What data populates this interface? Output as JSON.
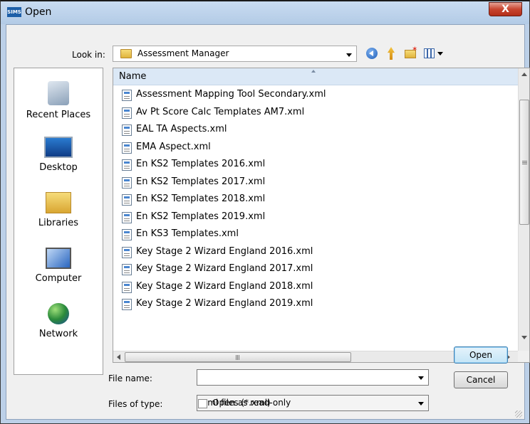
{
  "window": {
    "app_icon_text": "SIMS",
    "title": "Open",
    "close_label": "X"
  },
  "look_in": {
    "label": "Look in:",
    "value": "Assessment Manager"
  },
  "places": [
    {
      "label": "Recent Places",
      "icon": "recent-places-icon"
    },
    {
      "label": "Desktop",
      "icon": "desktop-icon"
    },
    {
      "label": "Libraries",
      "icon": "libraries-icon"
    },
    {
      "label": "Computer",
      "icon": "computer-icon"
    },
    {
      "label": "Network",
      "icon": "network-icon"
    }
  ],
  "file_list": {
    "column_header": "Name",
    "files": [
      "Assessment Mapping Tool Secondary.xml",
      "Av Pt Score Calc Templates AM7.xml",
      "EAL TA Aspects.xml",
      "EMA Aspect.xml",
      "En KS2 Templates 2016.xml",
      "En KS2 Templates 2017.xml",
      "En KS2 Templates 2018.xml",
      "En KS2 Templates 2019.xml",
      "En KS3 Templates.xml",
      "Key Stage 2 Wizard England 2016.xml",
      "Key Stage 2 Wizard England 2017.xml",
      "Key Stage 2 Wizard England 2018.xml",
      "Key Stage 2 Wizard England 2019.xml"
    ],
    "h_scroll_grip": "III"
  },
  "file_name": {
    "label": "File name:",
    "value": ""
  },
  "files_of_type": {
    "label": "Files of type:",
    "value": "Xml files (*.xml)"
  },
  "read_only": {
    "label": "Open as read-only",
    "checked": false
  },
  "buttons": {
    "open": "Open",
    "cancel": "Cancel"
  }
}
